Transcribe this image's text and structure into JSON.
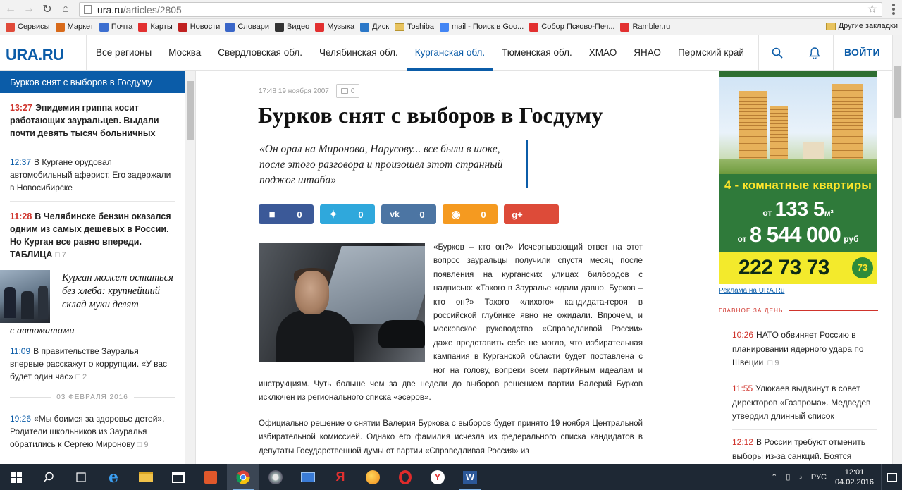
{
  "browser": {
    "url_host": "ura.ru",
    "url_path": "/articles/2805",
    "bookmarks": [
      {
        "label": "Сервисы",
        "icon": "apps-icon",
        "color": "#e04a3a"
      },
      {
        "label": "Маркет",
        "icon": "market-icon",
        "color": "#d86a1a"
      },
      {
        "label": "Почта",
        "icon": "mail-icon",
        "color": "#3d6fd0"
      },
      {
        "label": "Карты",
        "icon": "map-pin-icon",
        "color": "#e23030"
      },
      {
        "label": "Новости",
        "icon": "news-icon",
        "color": "#c02020"
      },
      {
        "label": "Словари",
        "icon": "dictionary-icon",
        "color": "#3a66c8"
      },
      {
        "label": "Видео",
        "icon": "video-icon",
        "color": "#333333"
      },
      {
        "label": "Музыка",
        "icon": "music-icon",
        "color": "#e23030"
      },
      {
        "label": "Диск",
        "icon": "disk-icon",
        "color": "#2b78c8"
      },
      {
        "label": "Toshiba",
        "icon": "folder-icon",
        "color": "#e8c35f"
      },
      {
        "label": "mail - Поиск в Goo...",
        "icon": "google-icon",
        "color": "#4285f4"
      },
      {
        "label": "Собор Псково-Печ...",
        "icon": "yandex-icon",
        "color": "#e23030"
      },
      {
        "label": "Rambler.ru",
        "icon": "yandex-icon",
        "color": "#e23030"
      }
    ],
    "other_bookmarks": "Другие закладки"
  },
  "site": {
    "logo": "URA.RU",
    "nav": [
      {
        "label": "Все регионы",
        "active": false
      },
      {
        "label": "Москва",
        "active": false
      },
      {
        "label": "Свердловская обл.",
        "active": false
      },
      {
        "label": "Челябинская обл.",
        "active": false
      },
      {
        "label": "Курганская обл.",
        "active": true
      },
      {
        "label": "Тюменская обл.",
        "active": false
      },
      {
        "label": "ХМАО",
        "active": false
      },
      {
        "label": "ЯНАО",
        "active": false
      },
      {
        "label": "Пермский край",
        "active": false
      }
    ],
    "login": "ВОЙТИ",
    "accent": "#0b5ca8"
  },
  "left": {
    "header": "Бурков снят с выборов в Госдуму",
    "news1": {
      "time": "13:27",
      "text": "Эпидемия гриппа косит работающих зауральцев. Выдали почти девять тысяч больничных"
    },
    "news2": {
      "time": "12:37",
      "text": "В Кургане орудовал автомобильный аферист. Его задержали в Новосибирске"
    },
    "news3": {
      "time": "11:28",
      "text": "В Челябинске бензин оказался одним из самых дешевых в России. Но Курган все равно впереди. ТАБЛИЦА",
      "count": "7"
    },
    "feature": {
      "title_a": "Курган может остаться без хлеба: крупнейший склад муки делят",
      "title_b": "с автоматами"
    },
    "news4": {
      "time": "11:09",
      "text": "В правительстве Зауралья впервые расскажут о коррупции. «У вас будет один час»",
      "count": "2"
    },
    "date": "03 ФЕВРАЛЯ 2016",
    "news5": {
      "time": "19:26",
      "text": "«Мы боимся за здоровье детей». Родители школьников из Зауралья обратились к Сергею Миронову",
      "count": "9"
    }
  },
  "article": {
    "time": "17:48",
    "date": "19 ноября 2007",
    "comments": "0",
    "title": "Бурков снят с выборов в Госдуму",
    "quote": "«Он орал на Миронова, Нарусову... все были в шоке, после этого разговора и произошел этот странный поджог штаба»",
    "shares": {
      "fb": "0",
      "tw": "0",
      "vk": "0",
      "ok": "0"
    },
    "p1": "«Бурков – кто он?» Исчерпывающий ответ на этот вопрос  зауральцы получили спустя месяц после появления на курганских улицах билбордов с надписью: «Такого в Зауралье ждали давно. Бурков – кто он?» Такого «лихого» кандидата-героя в российской глубинке явно не ожидали. Впрочем, и московское руководство «Справедливой России» даже представить себе не могло, что избирательная кампания в Курганской области будет поставлена с ног на голову, вопреки всем партийным идеалам и инструкциям. Чуть больше чем за две недели до выборов решением партии Валерий Бурков исключен из регионального списка «эсеров».",
    "p2": "Официально решение о снятии Валерия Буркова с выборов будет принято 19 ноября Центральной избирательной комиссией. Однако его фамилия исчезла из федерального списка кандидатов в депутаты Государственной думы от партии «Справедливая Россия» из"
  },
  "right": {
    "ad": {
      "line1": "4 - комнатные квартиры",
      "from1": "от",
      "area": "133 5",
      "area_unit": "м²",
      "from2": "от",
      "price": "8 544 000",
      "price_unit": "руб",
      "phone": "222 73 73",
      "badge": "73"
    },
    "ad_link": "Реклама на URA.Ru",
    "main_day": "ГЛАВНОЕ ЗА ДЕНЬ",
    "items": [
      {
        "time": "10:26",
        "text": "НАТО обвиняет Россию в планировании ядерного удара по Швеции",
        "count": "9"
      },
      {
        "time": "11:55",
        "text": "Улюкаев выдвинут в совет директоров «Газпрома». Медведев утвердил длинный список",
        "count": ""
      },
      {
        "time": "12:12",
        "text": "В России требуют отменить выборы из-за санкций. Боятся",
        "count": ""
      }
    ]
  },
  "taskbar": {
    "lang": "РУС",
    "time": "12:01",
    "date": "04.02.2016"
  }
}
